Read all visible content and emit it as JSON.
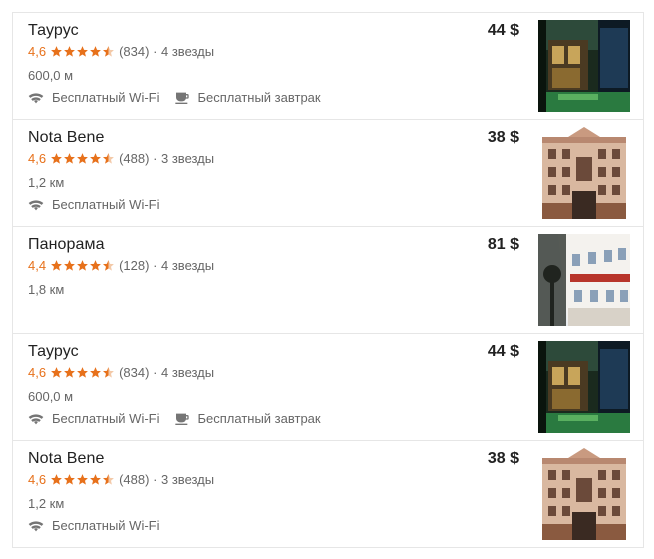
{
  "hotels": [
    {
      "name": "Таурус",
      "rating": "4,6",
      "stars": 4.5,
      "reviews": "(834)",
      "class": "· 4 звезды",
      "distance": "600,0 м",
      "wifi": "Бесплатный Wi-Fi",
      "breakfast": "Бесплатный завтрак",
      "price": "44 $"
    },
    {
      "name": "Nota Bene",
      "rating": "4,6",
      "stars": 4.5,
      "reviews": "(488)",
      "class": "· 3 звезды",
      "distance": "1,2 км",
      "wifi": "Бесплатный Wi-Fi",
      "breakfast": "",
      "price": "38 $"
    },
    {
      "name": "Панорама",
      "rating": "4,4",
      "stars": 4.5,
      "reviews": "(128)",
      "class": "· 4 звезды",
      "distance": "1,8 км",
      "wifi": "",
      "breakfast": "",
      "price": "81 $"
    },
    {
      "name": "Таурус",
      "rating": "4,6",
      "stars": 4.5,
      "reviews": "(834)",
      "class": "· 4 звезды",
      "distance": "600,0 м",
      "wifi": "Бесплатный Wi-Fi",
      "breakfast": "Бесплатный завтрак",
      "price": "44 $"
    },
    {
      "name": "Nota Bene",
      "rating": "4,6",
      "stars": 4.5,
      "reviews": "(488)",
      "class": "· 3 звезды",
      "distance": "1,2 км",
      "wifi": "Бесплатный Wi-Fi",
      "breakfast": "",
      "price": "38 $"
    }
  ],
  "colors": {
    "star": "#e7711b",
    "text_secondary": "#666666",
    "border": "#e6e6e6"
  },
  "icons": {
    "wifi": "wifi-icon",
    "breakfast": "coffee-cup-icon",
    "star": "star-icon",
    "half_star": "half-star-icon"
  }
}
